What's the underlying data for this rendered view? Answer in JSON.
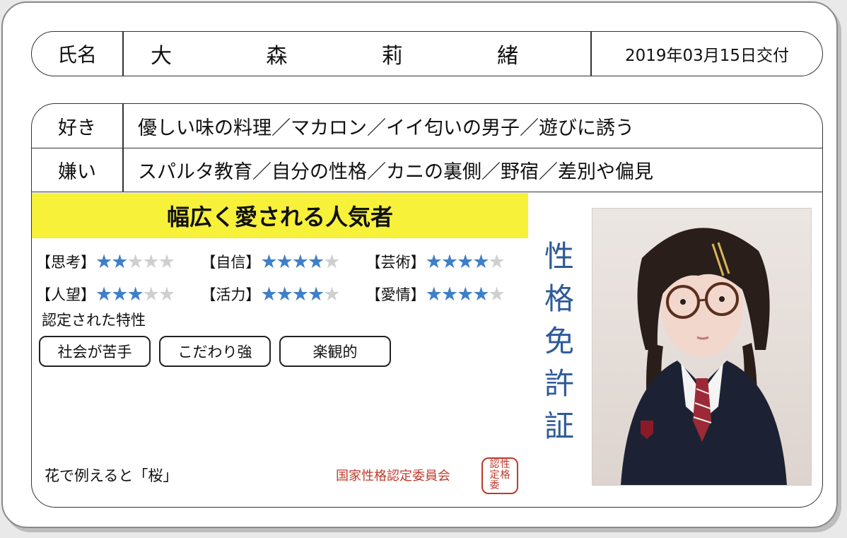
{
  "name": {
    "label": "氏名",
    "chars": [
      "大",
      "森",
      "莉",
      "緒"
    ],
    "issued": "2019年03月15日交付"
  },
  "likes": {
    "label": "好き",
    "text": "優しい味の料理／マカロン／イイ匂いの男子／遊びに誘う"
  },
  "dislikes": {
    "label": "嫌い",
    "text": "スパルタ教育／自分の性格／カニの裏側／野宿／差別や偏見"
  },
  "banner": "幅広く愛される人気者",
  "ratings": [
    [
      {
        "label": "【思考】",
        "stars": 2,
        "max": 5
      },
      {
        "label": "【自信】",
        "stars": 4,
        "max": 5
      },
      {
        "label": "【芸術】",
        "stars": 4,
        "max": 5
      }
    ],
    [
      {
        "label": "【人望】",
        "stars": 3,
        "max": 5
      },
      {
        "label": "【活力】",
        "stars": 4,
        "max": 5
      },
      {
        "label": "【愛情】",
        "stars": 4,
        "max": 5
      }
    ]
  ],
  "traits_title": "認定された特性",
  "traits": [
    "社会が苦手",
    "こだわり強",
    "楽観的"
  ],
  "flower": "花で例えると「桜」",
  "committee": "国家性格認定委員会",
  "seal_text": [
    "性格",
    "認定委"
  ],
  "vertical_title": [
    "性",
    "格",
    "免",
    "許",
    "証"
  ],
  "colors": {
    "star_on": "#3f7fc7",
    "star_off": "#cfcfcf",
    "banner": "#f7f13a",
    "title": "#2e5a98",
    "seal": "#c0392b"
  },
  "star_icon": "star-icon"
}
